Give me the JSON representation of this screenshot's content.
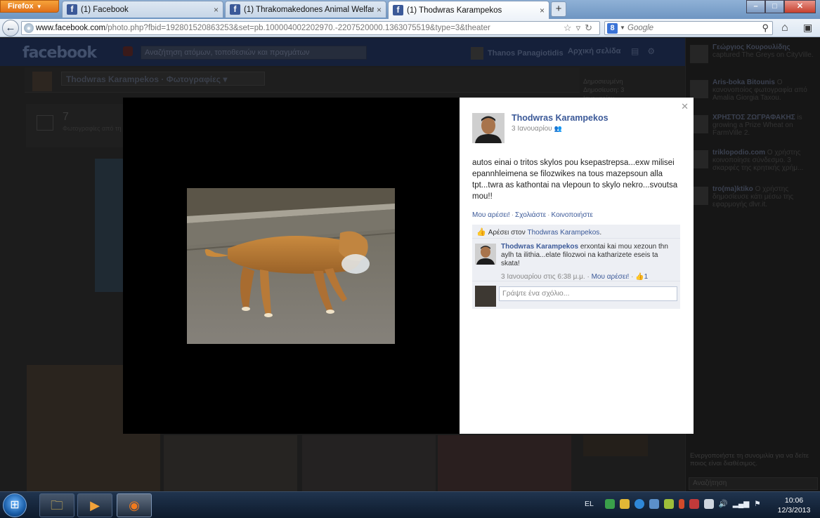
{
  "browser": {
    "menu_label": "Firefox",
    "tabs": [
      {
        "label": "(1) Facebook"
      },
      {
        "label": "(1) Thrakomakedones Animal Welfar..."
      },
      {
        "label": "(1) Thodwras Karampekos"
      }
    ],
    "url_domain": "www.facebook.com",
    "url_path": "/photo.php?fbid=192801520863253&set=pb.100004002202970.-2207520000.1363075519&type=3&theater",
    "search_placeholder": "Google"
  },
  "fb_page": {
    "logo": "facebook",
    "search_placeholder": "Αναζήτηση ατόμων, τοποθεσιών και πραγμάτων",
    "user_name": "Thanos Panagiotidis",
    "home_label": "Αρχική σελίδα",
    "profile_name": "Thodwras Karampekos",
    "profile_section": "Φωτογραφίες",
    "photos_count": "7",
    "photos_label": "Φωτογραφίες από τη Thodwras",
    "side_text": [
      "Δημοσιευμένη",
      "Δημοσίευση: 3",
      "Ιανουαρίου"
    ]
  },
  "ticker": {
    "items": [
      {
        "name": "Γεώργιος Κουρουλίδης",
        "text": "captured The Greys on CityVille."
      },
      {
        "name": "Aris-boka Bitounis",
        "text": "Ο κανονοποίος φωτογραφία από Amalia Giorgia Taxou."
      },
      {
        "name": "ΧΡΗΣΤΟΣ ΖΩΓΡΑΦΑΚΗΣ",
        "text": "is growing a Prize Wheat on FarmVille 2."
      },
      {
        "name": "triklopodio.com",
        "text": "Ο χρήστης κοινοποίησε σύνδεσμο. 3 σκαρφές της κρητικής χρήμ..."
      },
      {
        "name": "tro(ma)ktiko",
        "text": "Ο χρήστης δημοσίευσε κάτι μέσω της εφαρμογής dlvr.it."
      }
    ],
    "chat_note": "Ενεργοποιήστε τη συνομιλία για να δείτε ποιος είναι διαθέσιμος.",
    "chat_search": "Αναζήτηση"
  },
  "post": {
    "author": "Thodwras Karampekos",
    "date": "3 Ιανουαρίου",
    "text": "autos einai o tritos skylos pou ksepastrepsa...exw milisei epannhleimena se filozwikes na tous mazepsoun alla tpt...twra as kathontai na vlepoun to skylo nekro...svoutsa mou!!",
    "actions": [
      "Μου αρέσει!",
      "Σχολιάστε",
      "Κοινοποιήστε"
    ],
    "likes_prefix": "Αρέσει στον",
    "liker": "Thodwras Karampekos",
    "likes_suffix": ".",
    "comment": {
      "author": "Thodwras Karampekos",
      "text": "erxontai kai mou xezoun thn aylh ta ilithia...elate filozwoi na katharizete eseis ta skata!",
      "time": "3 Ιανουαρίου στις 6:38 μ.μ.",
      "like_link": "Μου αρέσει!",
      "like_count": "1"
    },
    "write_placeholder": "Γράψτε ένα σχόλιο..."
  },
  "taskbar": {
    "lang": "EL",
    "time": "10:06",
    "date": "12/3/2013"
  }
}
